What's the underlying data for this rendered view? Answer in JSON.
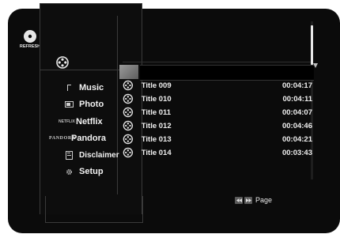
{
  "device_logo": {
    "text": "REFRESH"
  },
  "menu": {
    "items": [
      {
        "label": "Music",
        "icon": "music-note-icon"
      },
      {
        "label": "Photo",
        "icon": "photo-icon"
      },
      {
        "label": "Netflix",
        "icon": "netflix-logo",
        "logo_text": "NETFLIX"
      },
      {
        "label": "Pandora",
        "icon": "pandora-logo",
        "logo_text": "PANDORA"
      },
      {
        "label": "Disclaimer",
        "icon": "document-icon"
      },
      {
        "label": "Setup",
        "icon": "gear-icon"
      }
    ]
  },
  "files": [
    {
      "title": "Title 009",
      "duration": "00:04:17"
    },
    {
      "title": "Title 010",
      "duration": "00:04:11"
    },
    {
      "title": "Title 011",
      "duration": "00:04:07"
    },
    {
      "title": "Title 012",
      "duration": "00:04:46"
    },
    {
      "title": "Title 013",
      "duration": "00:04:21"
    },
    {
      "title": "Title 014",
      "duration": "00:03:43"
    }
  ],
  "page_hint": {
    "label": "Page"
  },
  "colors": {
    "background": "#0b0b0b",
    "text": "#f0f0f0",
    "divider": "#3a3a3a"
  }
}
